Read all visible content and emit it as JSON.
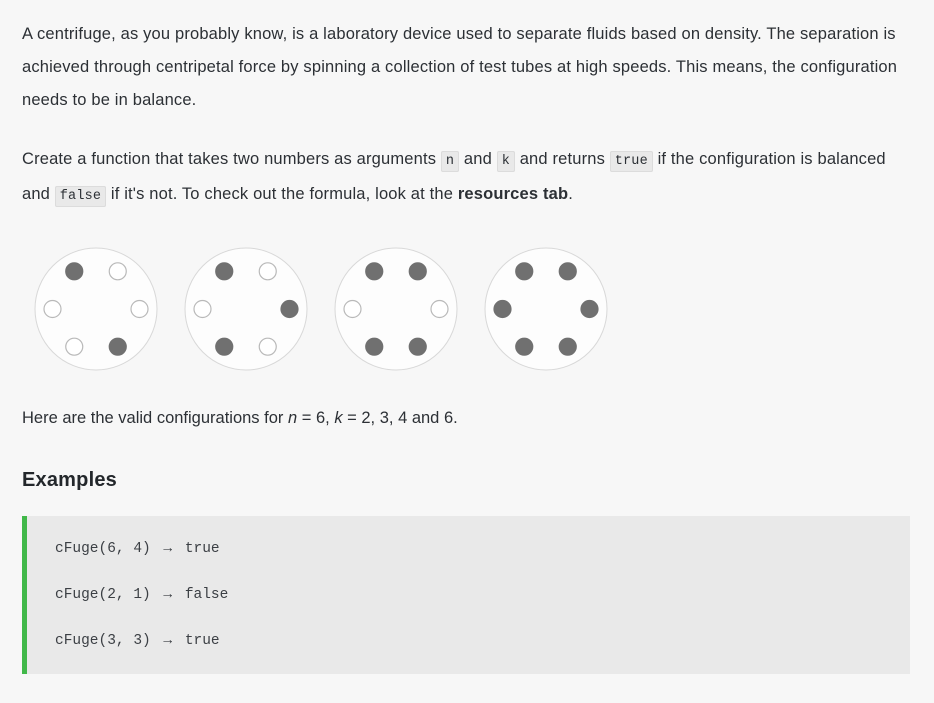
{
  "description": {
    "paragraph_1": "A centrifuge, as you probably know, is a laboratory device used to separate fluids based on density. The separation is achieved through centripetal force by spinning a collection of test tubes at high speeds. This means, the configuration needs to be in balance.",
    "paragraph_2": {
      "part_1": "Create a function that takes two numbers as arguments",
      "code_n": "n",
      "part_2": "and",
      "code_k": "k",
      "part_3": "and returns",
      "code_true": "true",
      "part_4": "if the configuration is balanced and",
      "code_false": "false",
      "part_5": "if it's not. To check out the formula, look at the",
      "bold_resources": "resources tab",
      "part_6": "."
    }
  },
  "caption": {
    "prefix": "Here are the valid configurations for ",
    "n_var": "n",
    "n_eq": " = 6, ",
    "k_var": "k",
    "k_eq": " = 2, 3, 4 and 6."
  },
  "examples": {
    "heading": "Examples",
    "lines": [
      {
        "call": "cFuge(6, 4)",
        "arrow": "→",
        "result": "true"
      },
      {
        "call": "cFuge(2, 1)",
        "arrow": "→",
        "result": "false"
      },
      {
        "call": "cFuge(3, 3)",
        "arrow": "→",
        "result": "true"
      }
    ]
  },
  "diagrams": {
    "slot_count": 6,
    "filled_color": "#707070",
    "empty_color": "#ffffff",
    "empty_stroke": "#b9b9b9",
    "disc_stroke": "#d8d8d8",
    "disc_fill": "#fdfdfd",
    "centrifuges": [
      {
        "label": "k=2",
        "k": 2,
        "filled": [
          true,
          false,
          false,
          true,
          false,
          false
        ]
      },
      {
        "label": "k=3",
        "k": 3,
        "filled": [
          true,
          false,
          true,
          false,
          true,
          false
        ]
      },
      {
        "label": "k=4",
        "k": 4,
        "filled": [
          true,
          true,
          false,
          true,
          true,
          false
        ]
      },
      {
        "label": "k=6",
        "k": 6,
        "filled": [
          true,
          true,
          true,
          true,
          true,
          true
        ]
      }
    ]
  },
  "colors": {
    "page_background": "#f7f7f7",
    "code_background": "#e9e9e9",
    "code_accent": "#41b849",
    "text": "#2c3035"
  }
}
